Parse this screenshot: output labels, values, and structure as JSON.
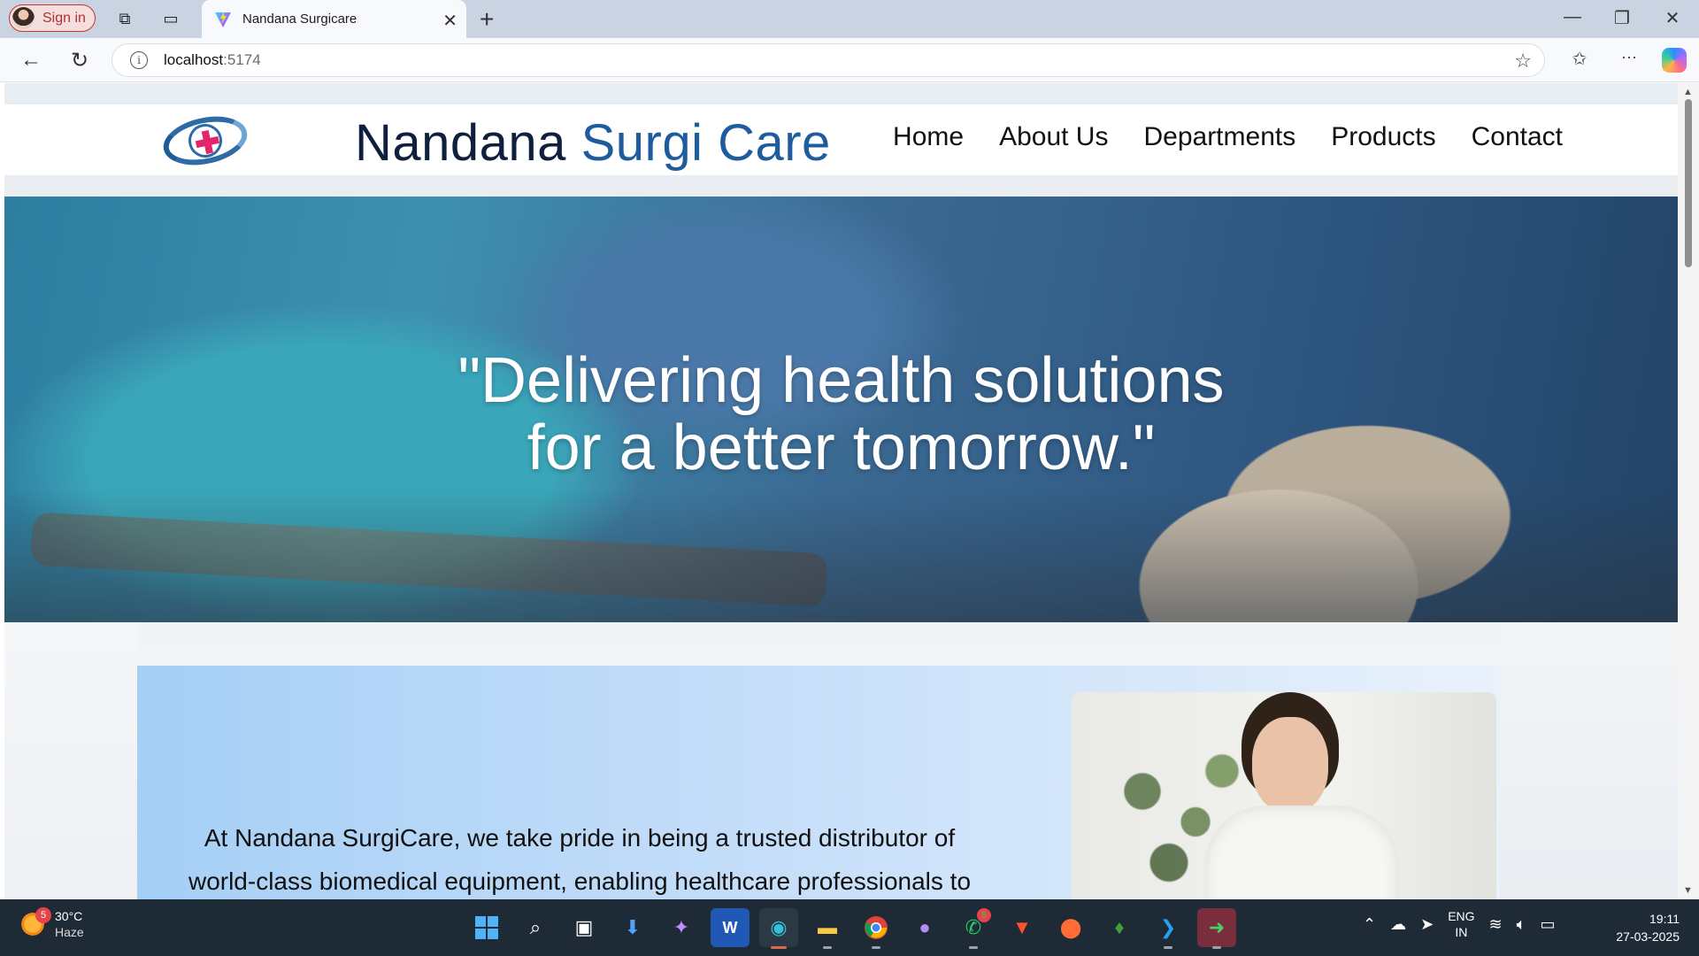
{
  "browser": {
    "profile_label": "Sign in",
    "tab_title": "Nandana Surgicare",
    "new_tab_symbol": "+",
    "url_host": "localhost",
    "url_port": ":5174",
    "icons": [
      "workspaces-icon",
      "tab-actions-icon",
      "vite-favicon-icon",
      "close-icon",
      "back-icon",
      "refresh-icon",
      "info-icon",
      "star-icon",
      "favorites-icon",
      "more-icon",
      "copilot-icon",
      "minimize-icon",
      "restore-icon",
      "close-window-icon"
    ]
  },
  "site": {
    "brand_part1": "Nandana",
    "brand_part2": "Surgi Care",
    "menu": [
      {
        "label": "Home"
      },
      {
        "label": "About Us"
      },
      {
        "label": "Departments"
      },
      {
        "label": "Products"
      },
      {
        "label": "Contact"
      }
    ],
    "hero_line1": "\"Delivering health solutions",
    "hero_line2": "for a better tomorrow.\"",
    "about_line1": "At Nandana SurgiCare, we take pride in being a trusted distributor of",
    "about_line2": "world-class biomedical equipment, enabling healthcare professionals to",
    "colors": {
      "brand_dark": "#0f1f3d",
      "brand_blue": "#1f5c9e",
      "logo_cross": "#e3256b",
      "about_bg": "#a6cff6"
    }
  },
  "taskbar": {
    "weather_temp": "30°C",
    "weather_desc": "Haze",
    "weather_badge": "5",
    "whatsapp_badge": "5",
    "lang_top": "ENG",
    "lang_bottom": "IN",
    "time": "19:11",
    "date": "27-03-2025"
  }
}
